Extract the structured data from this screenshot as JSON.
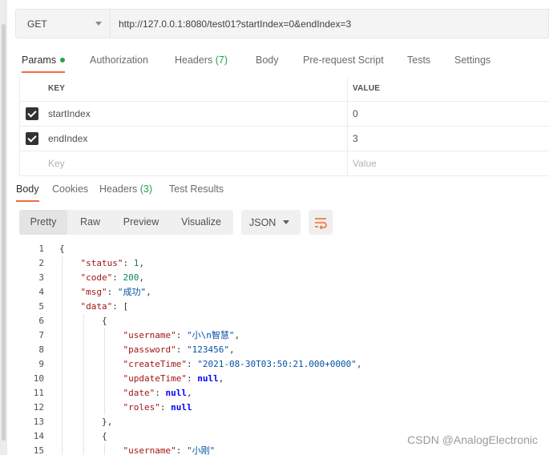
{
  "request": {
    "method": "GET",
    "url": "http://127.0.0.1:8080/test01?startIndex=0&endIndex=3"
  },
  "request_tabs": {
    "params": "Params",
    "authorization": "Authorization",
    "headers": "Headers",
    "headers_count": "(7)",
    "body": "Body",
    "prerequest": "Pre-request Script",
    "tests": "Tests",
    "settings": "Settings"
  },
  "params": {
    "header_key": "KEY",
    "header_value": "VALUE",
    "rows": [
      {
        "key": "startIndex",
        "value": "0",
        "checked": true
      },
      {
        "key": "endIndex",
        "value": "3",
        "checked": true
      }
    ],
    "placeholder_key": "Key",
    "placeholder_value": "Value"
  },
  "response_tabs": {
    "body": "Body",
    "cookies": "Cookies",
    "headers": "Headers",
    "headers_count": "(3)",
    "test_results": "Test Results"
  },
  "toolbar": {
    "pretty": "Pretty",
    "raw": "Raw",
    "preview": "Preview",
    "visualize": "Visualize",
    "format": "JSON"
  },
  "code_lines": [
    {
      "no": "1",
      "text": "{"
    },
    {
      "no": "2",
      "text": "\"status\": 1,"
    },
    {
      "no": "3",
      "text": "\"code\": 200,"
    },
    {
      "no": "4",
      "text": "\"msg\": \"成功\","
    },
    {
      "no": "5",
      "text": "\"data\": ["
    },
    {
      "no": "6",
      "text": "{"
    },
    {
      "no": "7",
      "text": "\"username\": \"小\\n智慧\","
    },
    {
      "no": "8",
      "text": "\"password\": \"123456\","
    },
    {
      "no": "9",
      "text": "\"createTime\": \"2021-08-30T03:50:21.000+0000\","
    },
    {
      "no": "10",
      "text": "\"updateTime\": null,"
    },
    {
      "no": "11",
      "text": "\"date\": null,"
    },
    {
      "no": "12",
      "text": "\"roles\": null"
    },
    {
      "no": "13",
      "text": "},"
    },
    {
      "no": "14",
      "text": "{"
    },
    {
      "no": "15",
      "text": "\"username\": \"小刚\""
    }
  ],
  "watermark": "CSDN @AnalogElectronic",
  "colors": {
    "accent": "#f26b3a",
    "success": "#22a34a",
    "json_key": "#a31515",
    "json_string": "#0451a5",
    "json_number": "#098658",
    "json_keyword": "#0000ff"
  }
}
